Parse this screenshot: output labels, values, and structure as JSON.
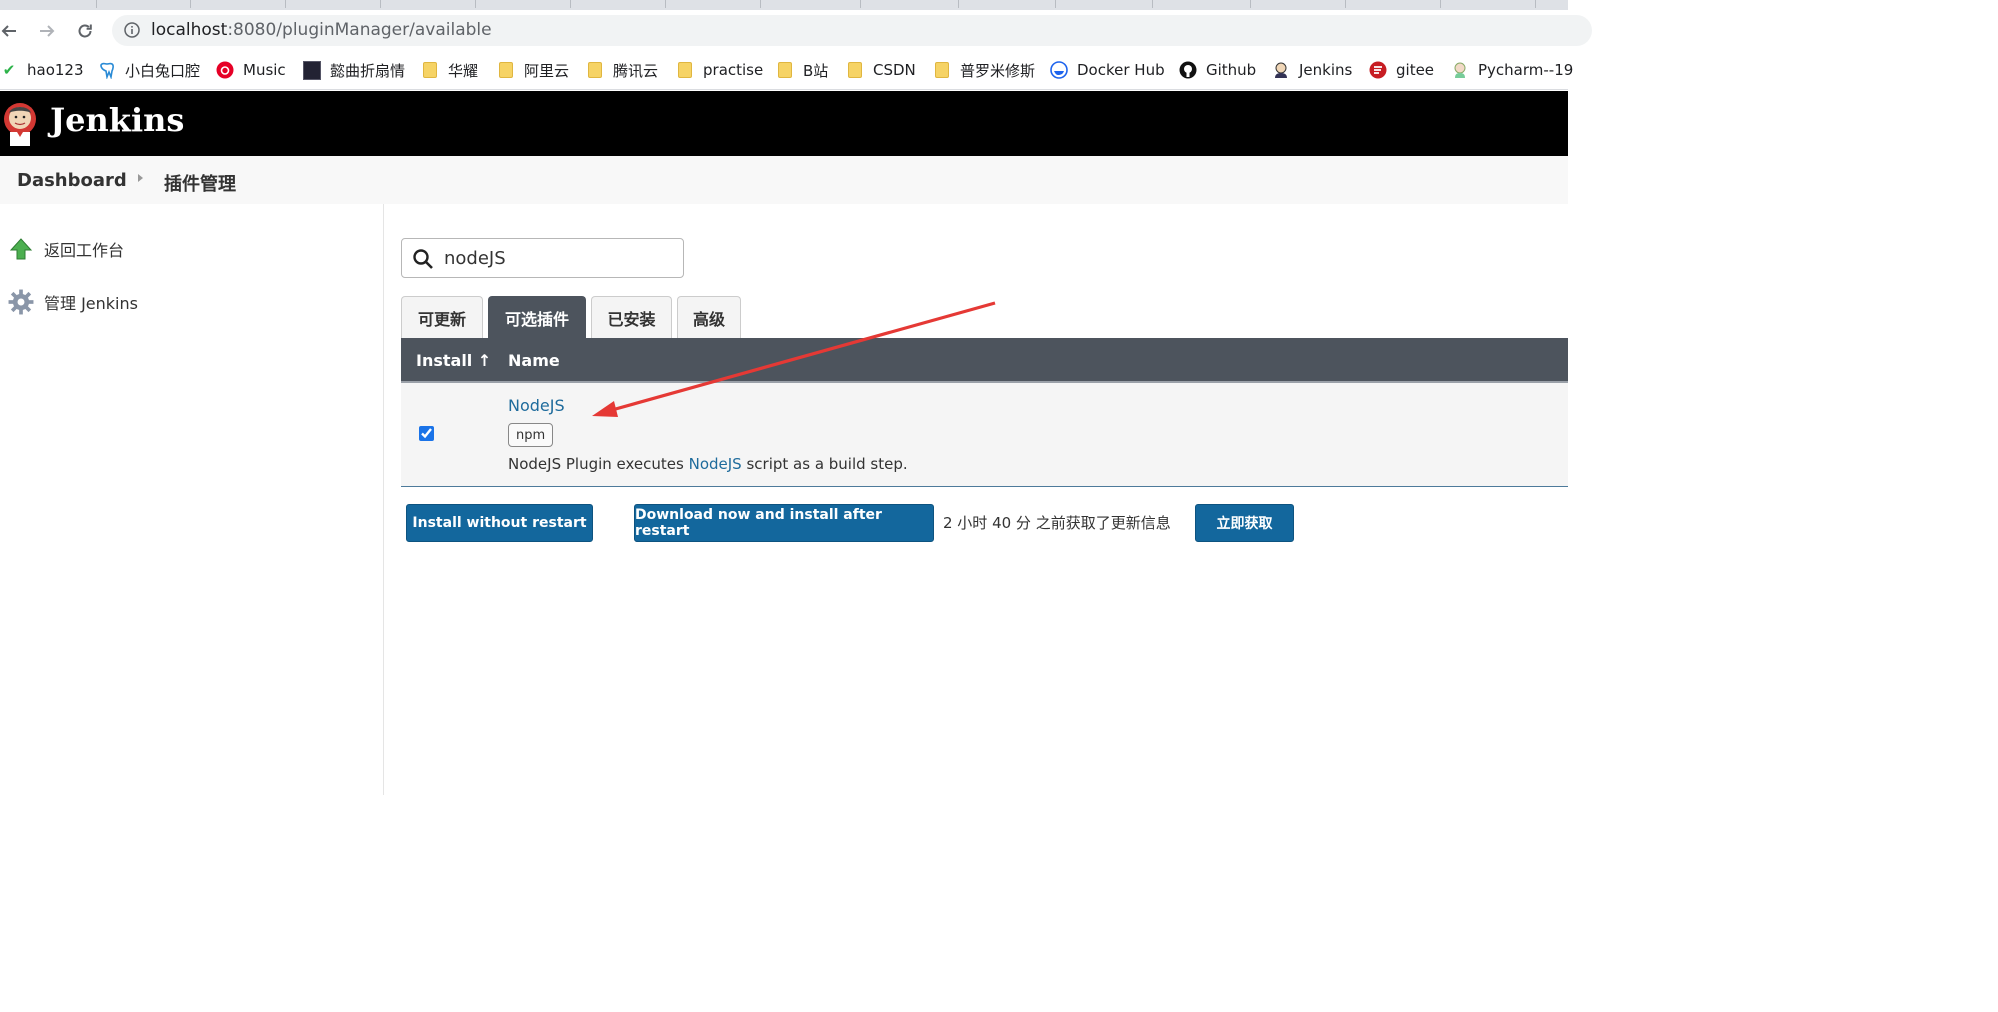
{
  "browser": {
    "url_host": "localhost",
    "url_rest": ":8080/pluginManager/available",
    "bookmarks": [
      {
        "label": "hao123",
        "icon": "hao123-icon"
      },
      {
        "label": "小白兔口腔",
        "icon": "tooth-icon"
      },
      {
        "label": "Music",
        "icon": "netease-music-icon"
      },
      {
        "label": "懿曲折扇情",
        "icon": "thumbnail-icon"
      },
      {
        "label": "华耀",
        "icon": "folder-icon"
      },
      {
        "label": "阿里云",
        "icon": "folder-icon"
      },
      {
        "label": "腾讯云",
        "icon": "folder-icon"
      },
      {
        "label": "practise",
        "icon": "folder-icon"
      },
      {
        "label": "B站",
        "icon": "folder-icon"
      },
      {
        "label": "CSDN",
        "icon": "folder-icon"
      },
      {
        "label": "普罗米修斯",
        "icon": "folder-icon"
      },
      {
        "label": "Docker Hub",
        "icon": "docker-icon"
      },
      {
        "label": "Github",
        "icon": "github-icon"
      },
      {
        "label": "Jenkins",
        "icon": "jenkins-icon"
      },
      {
        "label": "gitee",
        "icon": "gitee-icon"
      },
      {
        "label": "Pycharm--19",
        "icon": "pycharm-icon"
      }
    ]
  },
  "header": {
    "title": "Jenkins"
  },
  "breadcrumbs": {
    "dashboard": "Dashboard",
    "current": "插件管理"
  },
  "sidepanel": {
    "back": "返回工作台",
    "manage": "管理 Jenkins"
  },
  "search": {
    "value": "nodeJS"
  },
  "tabs": {
    "updates": "可更新",
    "available": "可选插件",
    "installed": "已安装",
    "advanced": "高级"
  },
  "table": {
    "col_install": "Install  ↑",
    "col_name": "Name",
    "row": {
      "name": "NodeJS",
      "tag": "npm",
      "excerpt_before": "NodeJS Plugin executes ",
      "excerpt_link": "NodeJS",
      "excerpt_after": " script as a build step.",
      "checked": true
    }
  },
  "actions": {
    "install_without_restart": "Install without restart",
    "download_install_after_restart": "Download now and install after restart",
    "update_info": "2 小时 40 分 之前获取了更新信息",
    "check_now": "立即获取"
  },
  "colors": {
    "header_bg": "#000000",
    "tab_active": "#4d545d",
    "button": "#13679d",
    "link": "#1e6b9c",
    "annotation_arrow": "#e53935"
  }
}
